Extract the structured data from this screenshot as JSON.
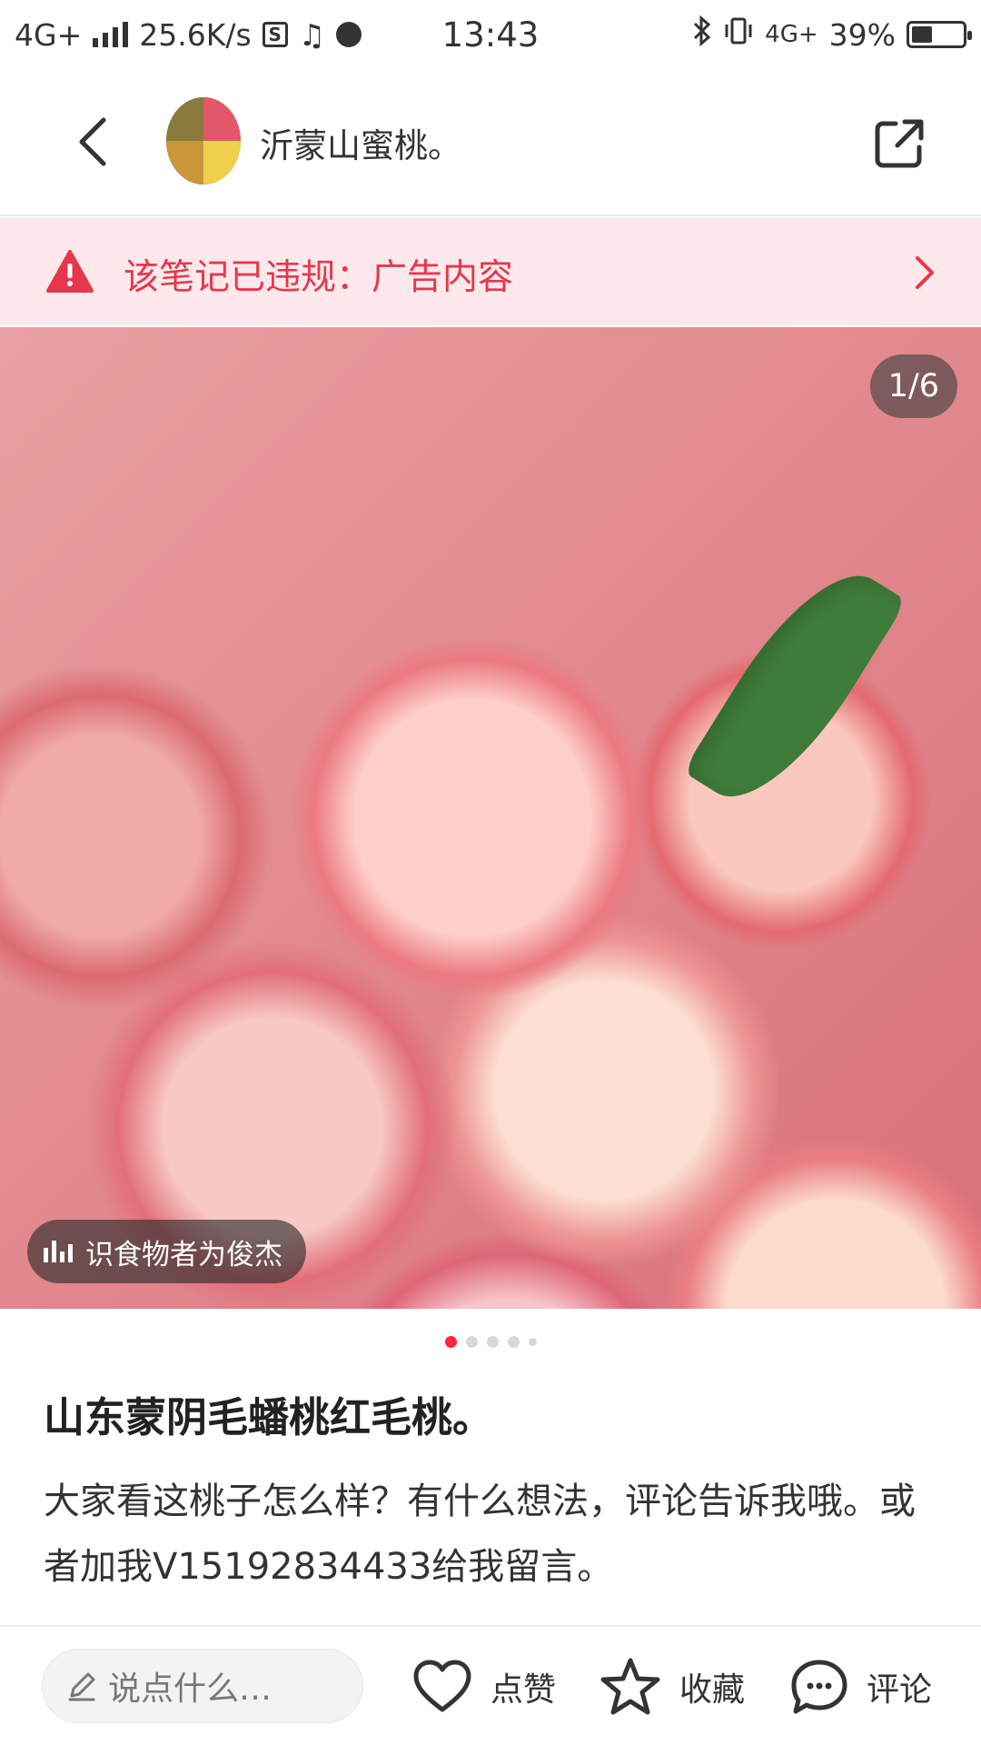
{
  "status_bar": {
    "network": "4G+",
    "speed": "25.6K/s",
    "time": "13:43",
    "network_right": "4G+",
    "battery": "39%",
    "battery_level": 0.39
  },
  "header": {
    "title": "沂蒙山蜜桃。"
  },
  "banner": {
    "text": "该笔记已违规：广告内容"
  },
  "image": {
    "counter": "1/6",
    "food_tag": "识食物者为俊杰",
    "total_pages": 6,
    "current_page": 1
  },
  "post": {
    "title": "山东蒙阴毛蟠桃红毛桃。",
    "description": "大家看这桃子怎么样？有什么想法，评论告诉我哦。或者加我V15192834433给我留言。"
  },
  "bottom_bar": {
    "comment_placeholder": "说点什么…",
    "like_label": "点赞",
    "favorite_label": "收藏",
    "comment_label": "评论"
  },
  "colors": {
    "accent": "#ff2442",
    "warning_text": "#e8364c",
    "banner_bg": "#fde9ec"
  }
}
